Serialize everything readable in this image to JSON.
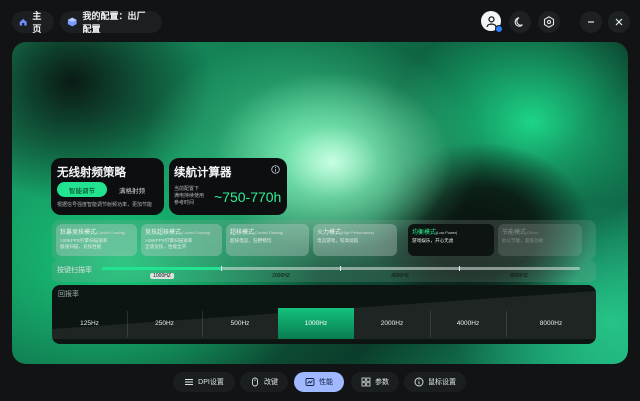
{
  "nav": {
    "home_label": "主页",
    "config_label": "我的配置：出厂配置"
  },
  "wireless": {
    "title": "无线射频策略",
    "smart_label": "智能调节",
    "full_label": "满格射频",
    "note": "根据信号强度智能调节射频功率，更加节能"
  },
  "battery": {
    "title": "续航计算器",
    "note": "当前配置下\n满电持续使用\n参考时间",
    "value": "~750-770h",
    "info_icon": "info-icon"
  },
  "modes": [
    {
      "title": "狂暴竞技模式",
      "tag": "(Corded Gaming)",
      "desc1": ">20KFPS引擎扫描速率",
      "desc2": "极速扫描、竞技性能"
    },
    {
      "title": "竞技超核模式",
      "tag": "(Corded Gaming)",
      "desc1": ">15KFPS引擎扫描速率",
      "desc2": "全速竞技，性能全开"
    },
    {
      "title": "超核模式",
      "tag": "(Corded Gaming)",
      "desc1": "超核电竞，狂野畅玩",
      "desc2": ""
    },
    {
      "title": "火力模式",
      "tag": "(High Performance)",
      "desc1": "电竞游戏，较高续航",
      "desc2": ""
    },
    {
      "title": "均衡模式",
      "tag": "(Low Power)",
      "desc1": "游戏娱乐，开心无虑",
      "desc2": ""
    },
    {
      "title": "节能模式",
      "tag": "(Office)",
      "desc1": "办公节能，超低功耗",
      "desc2": ""
    }
  ],
  "active_mode_index": 4,
  "polling": {
    "label": "按键扫描率",
    "ticks": [
      "1000HZ",
      "2000HZ",
      "4000HZ",
      "8000HZ"
    ],
    "selected": "1000HZ",
    "fill_fraction": 0.25
  },
  "report_rate": {
    "label": "回报率",
    "options": [
      "125Hz",
      "250Hz",
      "500Hz",
      "1000Hz",
      "2000Hz",
      "4000Hz",
      "8000Hz"
    ],
    "selected": "1000Hz"
  },
  "dock": {
    "dpi": "DPI设置",
    "keys": "改键",
    "performance": "性能",
    "params": "参数",
    "mouse": "鼠标设置"
  },
  "colors": {
    "accent": "#22e38f",
    "dock_active": "#9fb8ff"
  }
}
